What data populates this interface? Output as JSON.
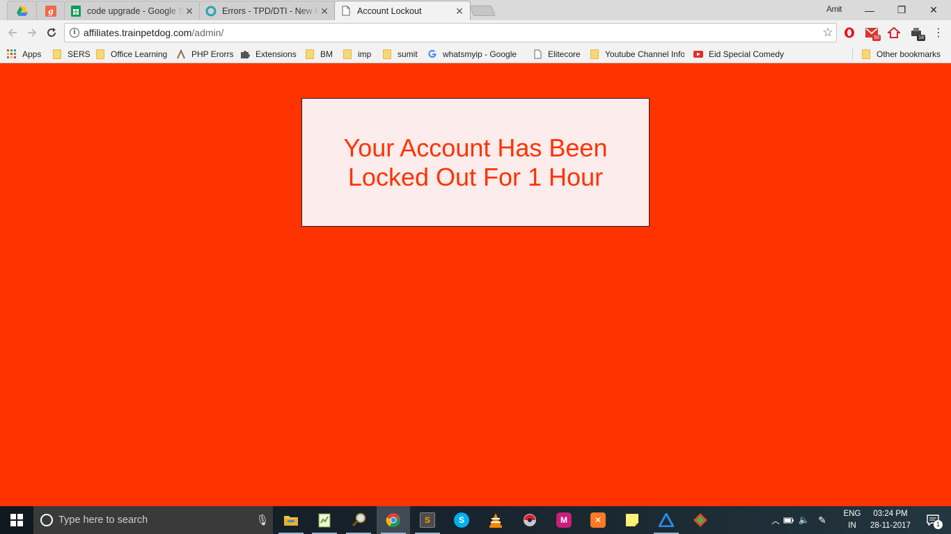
{
  "browser": {
    "tabs": [
      {
        "title": "",
        "favicon": "google-drive-icon",
        "pinned": true
      },
      {
        "title": "",
        "favicon": "goibibo-g-icon",
        "pinned": true
      },
      {
        "title": "code upgrade - Google S",
        "favicon": "google-sheets-icon"
      },
      {
        "title": "Errors - TPD/DTI - New R",
        "favicon": "teal-ring-icon"
      },
      {
        "title": "Account Lockout",
        "favicon": "page-icon",
        "active": true
      }
    ],
    "profile_name": "Amit",
    "window_controls": {
      "minimize": "—",
      "restore": "❐",
      "close": "✕"
    },
    "address": {
      "domain": "affiliates.trainpetdog.com",
      "path": "/admin/"
    },
    "extensions": [
      {
        "name": "opera-icon"
      },
      {
        "name": "gmail-notifier-icon",
        "badge": "50"
      },
      {
        "name": "home-red-icon"
      },
      {
        "name": "extension-printer-icon",
        "badge": "18"
      }
    ],
    "bookmarks": [
      {
        "label": "Apps",
        "icon": "apps-grid-icon"
      },
      {
        "label": "SERS",
        "icon": "folder-icon"
      },
      {
        "label": "Office Learning",
        "icon": "folder-icon"
      },
      {
        "label": "PHP Erorrs",
        "icon": "php-icon"
      },
      {
        "label": "Extensions",
        "icon": "puzzle-icon"
      },
      {
        "label": "BM",
        "icon": "folder-icon"
      },
      {
        "label": "imp",
        "icon": "folder-icon"
      },
      {
        "label": "sumit",
        "icon": "folder-icon"
      },
      {
        "label": "whatsmyip - Google S",
        "icon": "google-g-icon"
      },
      {
        "label": "Elitecore",
        "icon": "page-icon"
      },
      {
        "label": "Youtube Channel Info",
        "icon": "folder-icon"
      },
      {
        "label": "Eid Special Comedy N",
        "icon": "youtube-icon"
      }
    ],
    "other_bookmarks": "Other bookmarks"
  },
  "page": {
    "background_color": "#ff3300",
    "message_line1": "Your Account Has Been",
    "message_line2": "Locked Out For 1 Hour"
  },
  "taskbar": {
    "search_placeholder": "Type here to search",
    "apps": [
      "file-explorer-icon",
      "notepad-plus-icon",
      "magnifier-icon",
      "chrome-icon",
      "sublime-text-icon",
      "skype-icon",
      "vlc-icon",
      "filezilla-icon",
      "phpstorm-icon",
      "xampp-icon",
      "sticky-notes-icon",
      "teamviewer-icon",
      "git-icon"
    ],
    "language": "ENG",
    "region": "IN",
    "time": "03:24 PM",
    "date": "28-11-2017",
    "notification_count": "1"
  }
}
